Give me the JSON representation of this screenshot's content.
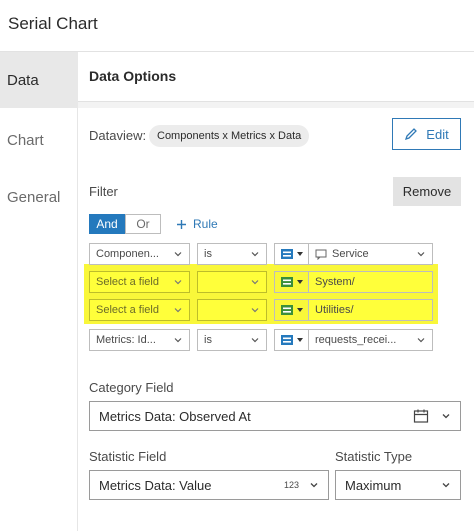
{
  "header": {
    "title": "Serial Chart"
  },
  "nav": {
    "items": [
      {
        "label": "Data",
        "active": true
      },
      {
        "label": "Chart",
        "active": false
      },
      {
        "label": "General",
        "active": false
      }
    ]
  },
  "panel": {
    "title": "Data Options",
    "dataview": {
      "label": "Dataview:",
      "value": "Components x Metrics x Data",
      "edit_label": "Edit"
    },
    "filter": {
      "label": "Filter",
      "remove_label": "Remove",
      "and_label": "And",
      "or_label": "Or",
      "add_rule_label": "Rule",
      "rules": [
        {
          "field": "Componen...",
          "operator": "is",
          "value": "Service",
          "value_icon": "chat-icon",
          "highlighted": false
        },
        {
          "field": "Select a field",
          "operator": "",
          "value": "System/",
          "value_icon": "",
          "highlighted": true
        },
        {
          "field": "Select a field",
          "operator": "",
          "value": "Utilities/",
          "value_icon": "",
          "highlighted": true
        },
        {
          "field": "Metrics: Id...",
          "operator": "is",
          "value": "requests_recei...",
          "value_icon": "",
          "highlighted": false
        }
      ]
    },
    "category": {
      "label": "Category Field",
      "value": "Metrics Data: Observed At"
    },
    "statistic": {
      "field_label": "Statistic Field",
      "field_value": "Metrics Data: Value",
      "field_badge": "123",
      "type_label": "Statistic Type",
      "type_value": "Maximum"
    }
  },
  "colors": {
    "accent": "#2479bd",
    "highlight": "#ffff3a",
    "panel_bg": "#f3f3f3"
  }
}
